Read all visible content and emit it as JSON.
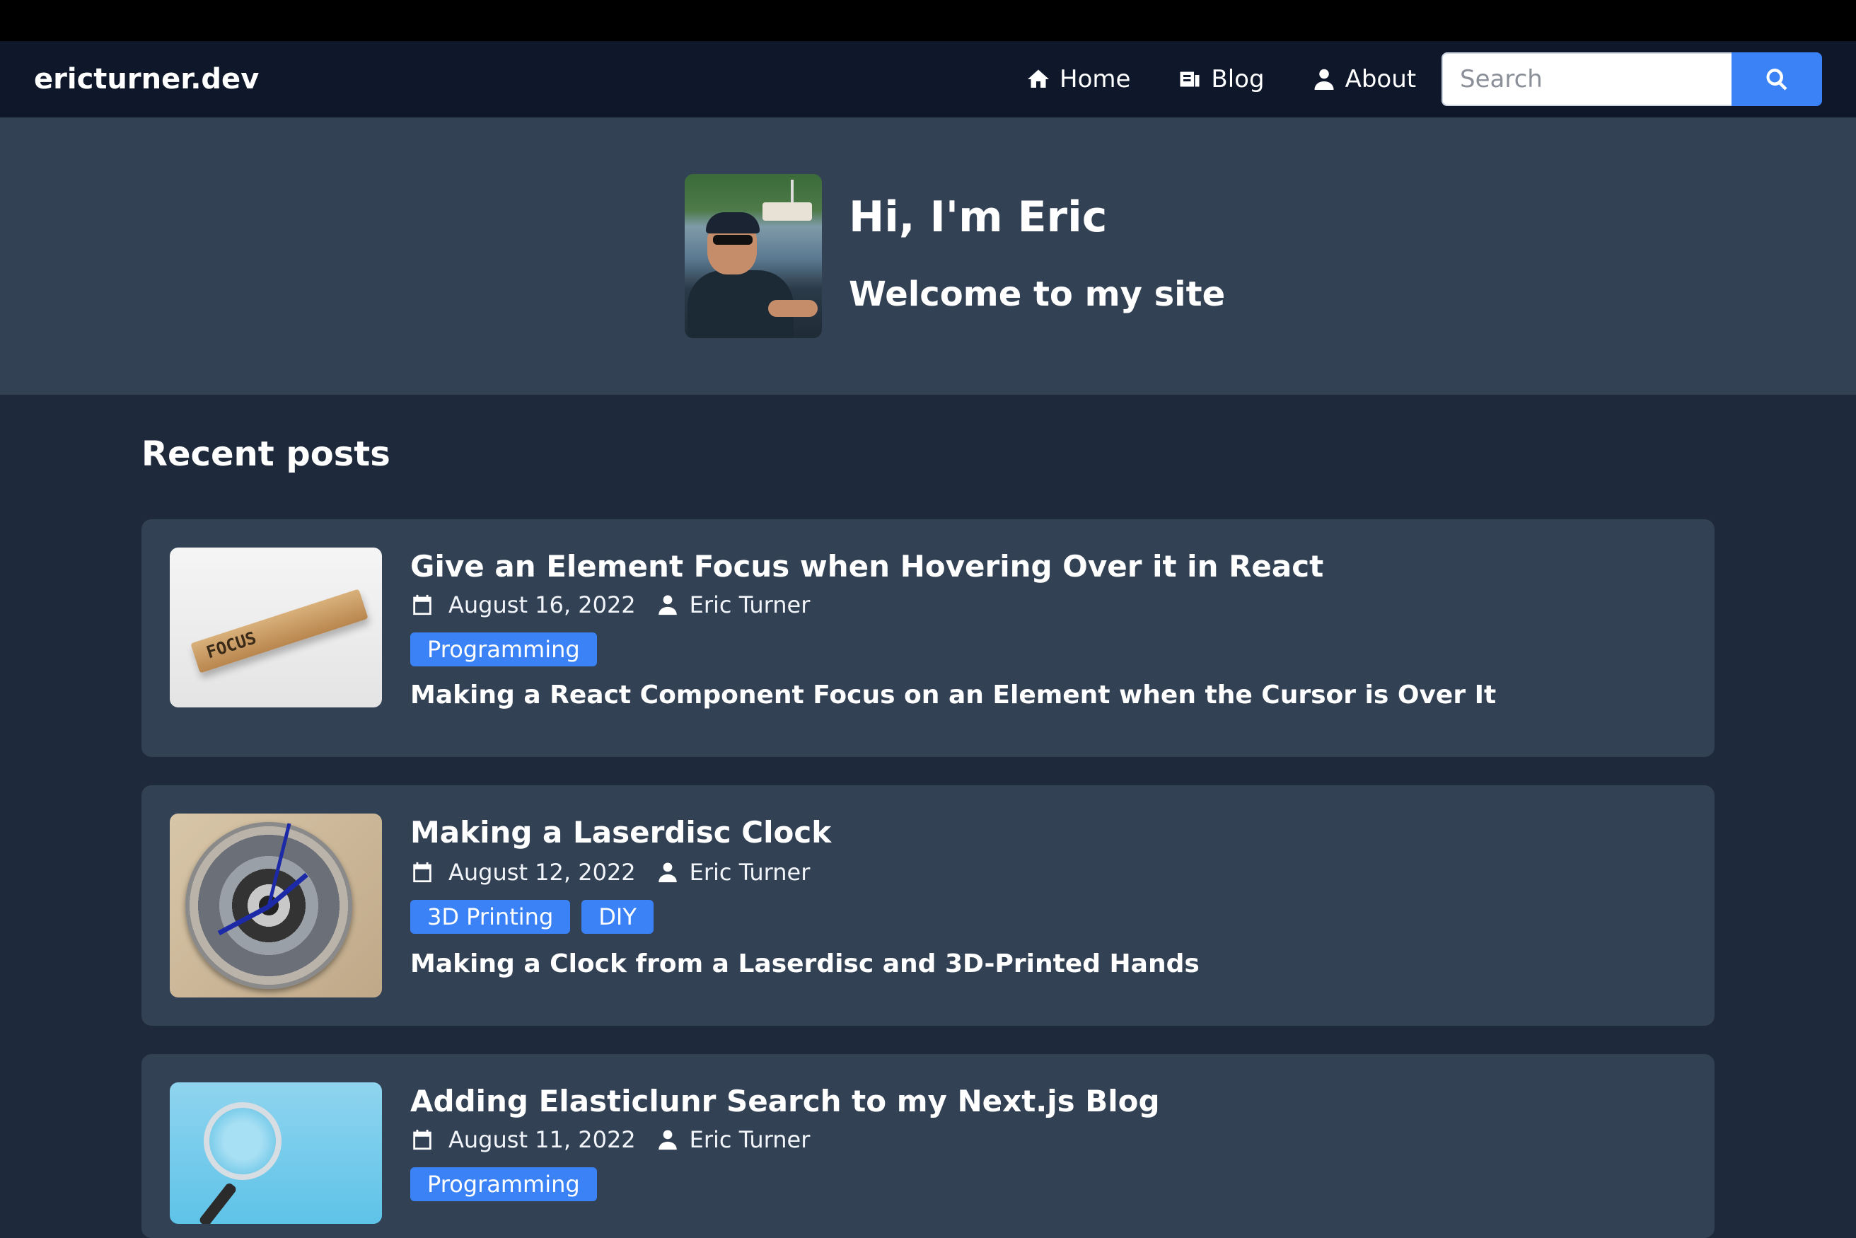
{
  "site": {
    "brand": "ericturner.dev"
  },
  "nav": {
    "items": [
      {
        "label": "Home",
        "icon": "home-icon"
      },
      {
        "label": "Blog",
        "icon": "blog-icon"
      },
      {
        "label": "About",
        "icon": "person-icon"
      }
    ],
    "search": {
      "placeholder": "Search",
      "button_icon": "search-icon"
    }
  },
  "hero": {
    "heading": "Hi, I'm Eric",
    "subheading": "Welcome to my site"
  },
  "recent": {
    "title": "Recent posts",
    "posts": [
      {
        "title": "Give an Element Focus when Hovering Over it in React",
        "date": "August 16, 2022",
        "author": "Eric Turner",
        "tags": [
          "Programming"
        ],
        "summary": "Making a React Component Focus on an Element when the Cursor is Over It",
        "thumb_text": "FOCUS"
      },
      {
        "title": "Making a Laserdisc Clock",
        "date": "August 12, 2022",
        "author": "Eric Turner",
        "tags": [
          "3D Printing",
          "DIY"
        ],
        "summary": "Making a Clock from a Laserdisc and 3D-Printed Hands"
      },
      {
        "title": "Adding Elasticlunr Search to my Next.js Blog",
        "date": "August 11, 2022",
        "author": "Eric Turner",
        "tags": [
          "Programming"
        ]
      }
    ]
  },
  "colors": {
    "page_bg": "#1e293b",
    "navbar_bg": "#0f172a",
    "hero_bg": "#334155",
    "card_bg": "#334155",
    "accent": "#3b82f6"
  }
}
